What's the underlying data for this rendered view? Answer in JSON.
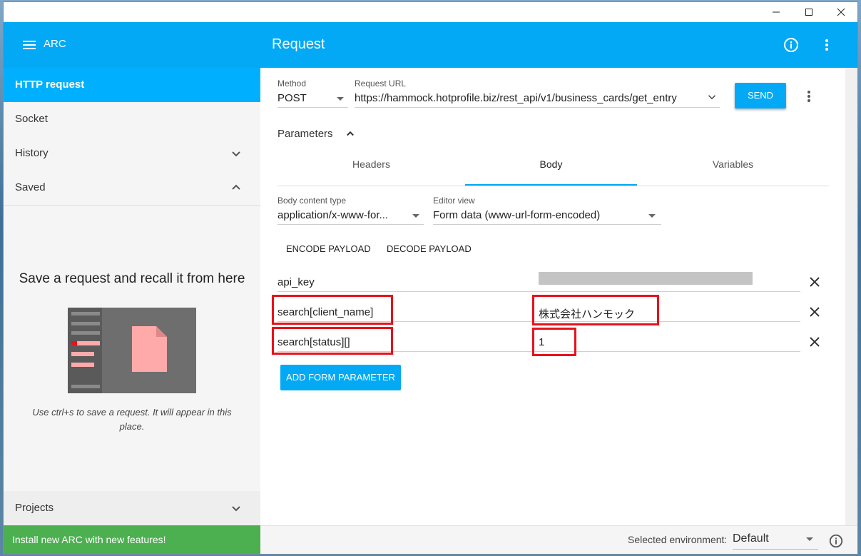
{
  "window": {
    "controls": [
      "minimize-icon",
      "maximize-icon",
      "close-icon"
    ]
  },
  "app": {
    "name": "ARC"
  },
  "sidebar": {
    "items": [
      {
        "label": "HTTP request",
        "active": true
      },
      {
        "label": "Socket"
      },
      {
        "label": "History",
        "icon": "chevron-down-icon"
      },
      {
        "label": "Saved",
        "icon": "chevron-up-icon"
      }
    ],
    "saved_empty": {
      "title": "Save a request and recall it from here",
      "hint": "Use ctrl+s to save a request. It will appear in this place."
    },
    "projects_label": "Projects",
    "banner": "Install new ARC with new features!"
  },
  "header": {
    "title": "Request"
  },
  "request": {
    "method_label": "Method",
    "method": "POST",
    "url_label": "Request URL",
    "url": "https://hammock.hotprofile.biz/rest_api/v1/business_cards/get_entry",
    "send_label": "SEND",
    "parameters_label": "Parameters"
  },
  "tabs": [
    {
      "label": "Headers"
    },
    {
      "label": "Body",
      "selected": true
    },
    {
      "label": "Variables"
    }
  ],
  "body": {
    "content_type_label": "Body content type",
    "content_type": "application/x-www-for...",
    "editor_label": "Editor view",
    "editor": "Form data (www-url-form-encoded)",
    "encode_label": "ENCODE PAYLOAD",
    "decode_label": "DECODE PAYLOAD",
    "params": [
      {
        "name": "api_key",
        "value": ""
      },
      {
        "name": "search[client_name]",
        "value": "株式会社ハンモック"
      },
      {
        "name": "search[status][]",
        "value": "1"
      }
    ],
    "add_label": "ADD FORM PARAMETER"
  },
  "footer": {
    "env_label": "Selected environment:",
    "env_value": "Default"
  },
  "colors": {
    "accent": "#03a9f4",
    "active_nav": "#00b0ff",
    "banner": "#4caf50",
    "highlight": "#e8121a"
  }
}
